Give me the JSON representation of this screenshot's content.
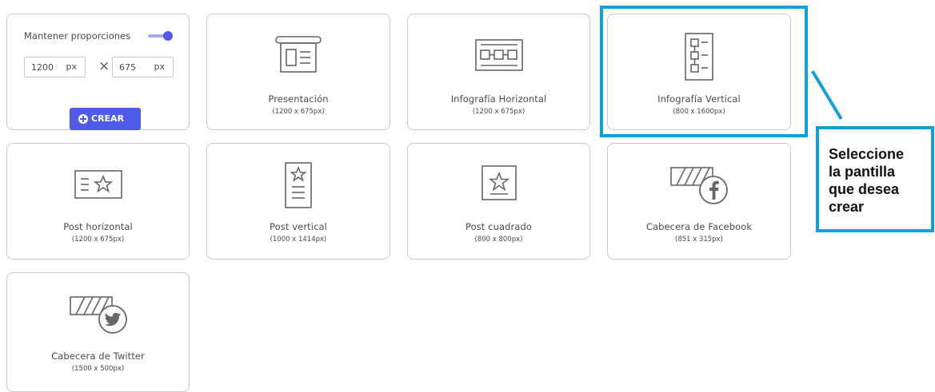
{
  "settings": {
    "keep_proportions_label": "Mantener proporciones",
    "keep_proportions_on": true,
    "width_value": "1200",
    "width_unit": "px",
    "times_symbol": "×",
    "height_value": "675",
    "height_unit": "px",
    "create_label": "CREAR",
    "accent_color": "#4f5ae8"
  },
  "templates": [
    {
      "title": "Presentación",
      "size": "(1200 x 675px)",
      "icon": "presentation-icon"
    },
    {
      "title": "Infografía Horizontal",
      "size": "(1200 x 675px)",
      "icon": "infographic-horizontal-icon"
    },
    {
      "title": "Infografía Vertical",
      "size": "(800 x 1600px)",
      "icon": "infographic-vertical-icon"
    },
    {
      "title": "Post horizontal",
      "size": "(1200 x 675px)",
      "icon": "post-horizontal-icon"
    },
    {
      "title": "Post vertical",
      "size": "(1000 x 1414px)",
      "icon": "post-vertical-icon"
    },
    {
      "title": "Post cuadrado",
      "size": "(800 x 800px)",
      "icon": "post-square-icon"
    },
    {
      "title": "Cabecera de Facebook",
      "size": "(851 x 315px)",
      "icon": "facebook-header-icon"
    },
    {
      "title": "Cabecera de Twitter",
      "size": "(1500 x 500px)",
      "icon": "twitter-header-icon"
    }
  ],
  "annotation": {
    "text_lines": [
      "Seleccione",
      "la pantilla",
      "que desea",
      "crear"
    ],
    "highlight_color": "#139fde"
  }
}
